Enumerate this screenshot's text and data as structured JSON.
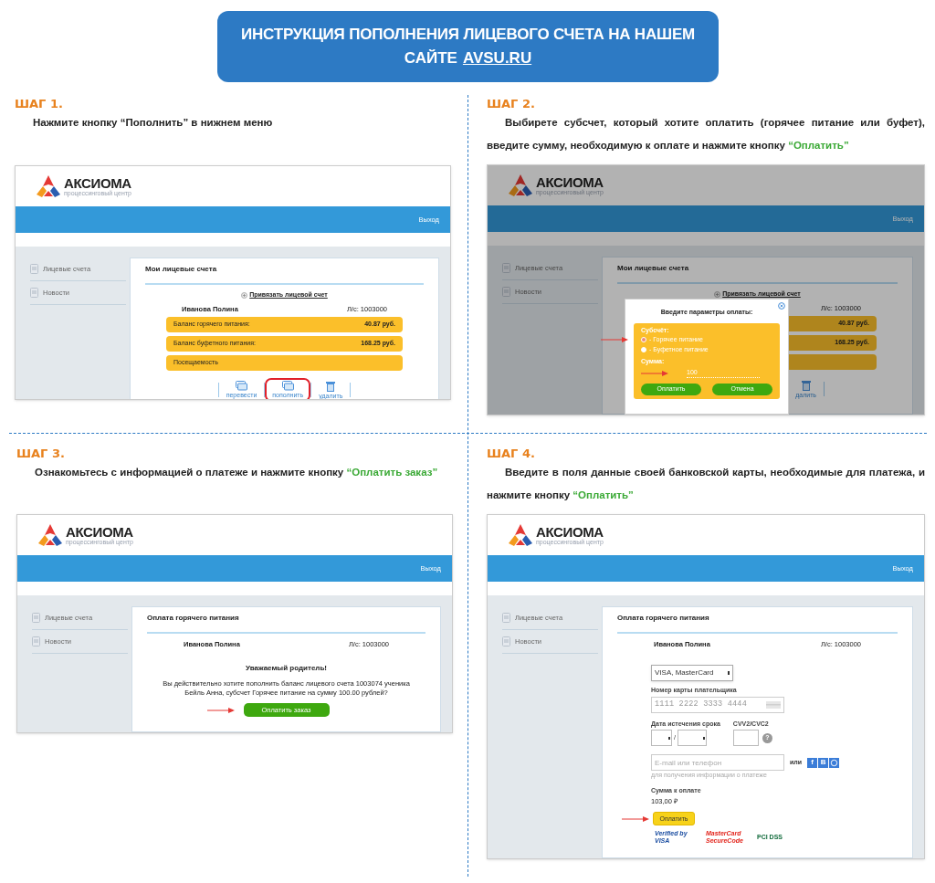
{
  "banner": {
    "line1": "ИНСТРУКЦИЯ ПОПОЛНЕНИЯ ЛИЦЕВОГО СЧЕТА НА НАШЕМ",
    "line2": "САЙТЕ",
    "link": "AVSU.RU"
  },
  "steps": [
    {
      "label": "ШАГ 1.",
      "instruction": [
        {
          "text": "Нажмите кнопку “Пополнить” в нижнем меню",
          "highlight": false
        }
      ],
      "screen": {
        "logo": {
          "name": "АКСИОМА",
          "tagline": "процессинговый центр"
        },
        "logout": "Выход",
        "dimmed": false,
        "sidebar": [
          {
            "label": "Лицевые счета"
          },
          {
            "label": "Новости"
          }
        ],
        "panel": {
          "kind": "accounts",
          "title": "Мои лицевые счета",
          "link": "Привязать лицевой счет",
          "name": "Иванова Полина",
          "account": "Л/с: 1003000",
          "rows": [
            {
              "label": "Баланс горячего питания:",
              "value": "40.87 руб."
            },
            {
              "label": "Баланс буфетного питания:",
              "value": "168.25 руб."
            },
            {
              "label": "Посещаемость"
            }
          ],
          "actions": [
            {
              "kind": "card",
              "label": "перевести",
              "circled": false
            },
            {
              "kind": "card",
              "label": "пополнить",
              "circled": true
            },
            {
              "kind": "trash",
              "label": "удалить",
              "circled": false
            }
          ]
        }
      }
    },
    {
      "label": "ШАГ 2.",
      "instruction": [
        {
          "text": "Выбирете субсчет, который хотите оплатить (горячее питание или буфет), введите сумму, необходимую к оплате и нажмите кнопку ",
          "highlight": false
        },
        {
          "text": "“Оплатить”",
          "highlight": true
        }
      ],
      "screen": {
        "logo": {
          "name": "АКСИОМА",
          "tagline": "процессинговый центр"
        },
        "logout": "Выход",
        "dimmed": true,
        "sidebar": [
          {
            "label": "Лицевые счета"
          },
          {
            "label": "Новости"
          }
        ],
        "panel": {
          "kind": "accounts",
          "title": "Мои лицевые счета",
          "link": "Привязать лицевой счет",
          "account": "Л/с: 1003000",
          "rows": [
            {
              "value": "40.87 руб."
            },
            {
              "value": "168.25 руб."
            },
            {}
          ],
          "actions": [
            {
              "kind": "trash",
              "label": "далить",
              "circled": false
            }
          ]
        },
        "modal": {
          "title": "Введите параметры оплаты:",
          "subaccount_label": "Субсчёт:",
          "options": [
            {
              "label": "- Горячее питание",
              "selected": true,
              "pointer": true
            },
            {
              "label": "- Буфетное питание",
              "selected": false,
              "pointer": false
            }
          ],
          "sum_label": "Сумма:",
          "sum_value": "100",
          "sum_pointer": true,
          "buttons": [
            "Оплатить",
            "Отмена"
          ]
        }
      }
    },
    {
      "label": "ШАГ 3.",
      "instruction": [
        {
          "text": "Ознакомьтесь с информацией о платеже и нажмите кнопку ",
          "highlight": false
        },
        {
          "text": "“Оплатить заказ”",
          "highlight": true
        }
      ],
      "screen": {
        "logo": {
          "name": "АКСИОМА",
          "tagline": "процессинговый центр"
        },
        "logout": "Выход",
        "dimmed": false,
        "sidebar": [
          {
            "label": "Лицевые счета"
          },
          {
            "label": "Новости"
          }
        ],
        "panel": {
          "kind": "confirm",
          "title": "Оплата горячего питания",
          "name": "Иванова Полина",
          "account": "Л/с: 1003000",
          "heading": "Уважаемый родитель!",
          "message": "Вы действительно хотите пополнить баланс лицевого счета 1003074 ученика Бейль Анна, субсчет Горячее питание на сумму 100.00 рублей?",
          "button": "Оплатить заказ",
          "pointer": true
        }
      }
    },
    {
      "label": "ШАГ 4.",
      "instruction": [
        {
          "text": "Введите в поля данные своей банковской карты, необходимые для платежа, и нажмите  кнопку ",
          "highlight": false
        },
        {
          "text": "“Оплатить”",
          "highlight": true
        }
      ],
      "screen": {
        "logo": {
          "name": "АКСИОМА",
          "tagline": "процессинговый центр"
        },
        "logout": "Выход",
        "dimmed": false,
        "sidebar": [
          {
            "label": "Лицевые счета"
          },
          {
            "label": "Новости"
          }
        ],
        "panel": {
          "kind": "card_form",
          "title": "Оплата горячего питания",
          "name": "Иванова Полина",
          "account": "Л/с: 1003000",
          "card_type": "VISA, MasterCard",
          "card_label": "Номер карты плательщика",
          "card_placeholder": "1111 2222 3333 4444",
          "expiry_label": "Дата истечения срока",
          "expiry_separator": "/",
          "cvv_label": "CVV2/CVC2",
          "help": "?",
          "email_placeholder": "E-mail или телефон",
          "or": "или",
          "social": [
            "f",
            "В"
          ],
          "email_hint": "для получения информации о платеже",
          "sum_label": "Сумма к оплате",
          "sum": "103,00 ₽",
          "button": "Оплатить",
          "pointer": true,
          "badges": [
            "Verified by VISA",
            "MasterCard SecureCode",
            "PCI DSS"
          ]
        }
      }
    }
  ]
}
